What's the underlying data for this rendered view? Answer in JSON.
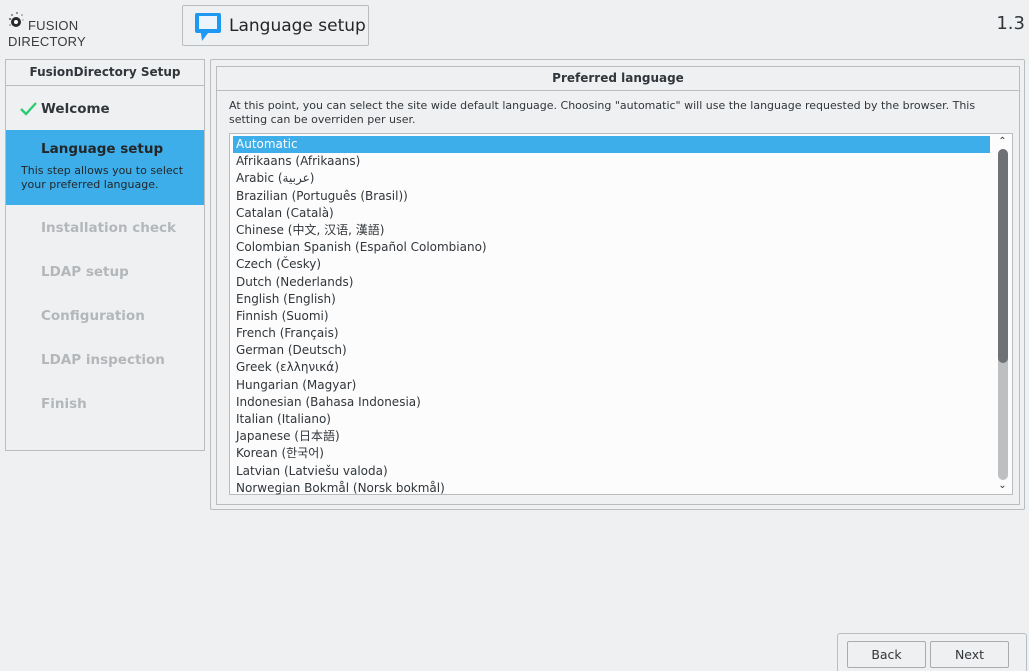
{
  "header": {
    "logo_line1": "FUSION",
    "logo_line2": "DIRECTORY",
    "page_title": "Language setup",
    "version": "1.3"
  },
  "sidebar": {
    "title": "FusionDirectory Setup",
    "steps": [
      {
        "label": "Welcome",
        "state": "done"
      },
      {
        "label": "Language setup",
        "state": "active",
        "description": "This step allows you to select your preferred language."
      },
      {
        "label": "Installation check",
        "state": "pending"
      },
      {
        "label": "LDAP setup",
        "state": "pending"
      },
      {
        "label": "Configuration",
        "state": "pending"
      },
      {
        "label": "LDAP inspection",
        "state": "pending"
      },
      {
        "label": "Finish",
        "state": "pending"
      }
    ]
  },
  "main": {
    "section_title": "Preferred language",
    "intro": "At this point, you can select the site wide default language. Choosing \"automatic\" will use the language requested by the browser. This setting can be overriden per user.",
    "selected_language": "Automatic",
    "languages": [
      "Automatic",
      "Afrikaans (Afrikaans)",
      "Arabic (عربية)",
      "Brazilian (Português (Brasil))",
      "Catalan (Català)",
      "Chinese (中文, 汉语, 漢語)",
      "Colombian Spanish (Español Colombiano)",
      "Czech (Česky)",
      "Dutch (Nederlands)",
      "English (English)",
      "Finnish (Suomi)",
      "French (Français)",
      "German (Deutsch)",
      "Greek (ελληνικά)",
      "Hungarian (Magyar)",
      "Indonesian (Bahasa Indonesia)",
      "Italian (Italiano)",
      "Japanese (日本語)",
      "Korean (한국어)",
      "Latvian (Latviešu valoda)",
      "Norwegian Bokmål (Norsk bokmål)"
    ],
    "scroll_position": 0.0
  },
  "footer": {
    "back_label": "Back",
    "next_label": "Next"
  },
  "colors": {
    "accent": "#3daee9",
    "background": "#eff0f1",
    "border": "#babdbf",
    "check": "#2ecc71"
  },
  "icons": {
    "logo": "fusiondirectory-logo",
    "title": "speech-bubble-icon",
    "welcome_done": "checkmark-icon",
    "scroll_up": "chevron-up-icon",
    "scroll_down": "chevron-down-icon"
  }
}
